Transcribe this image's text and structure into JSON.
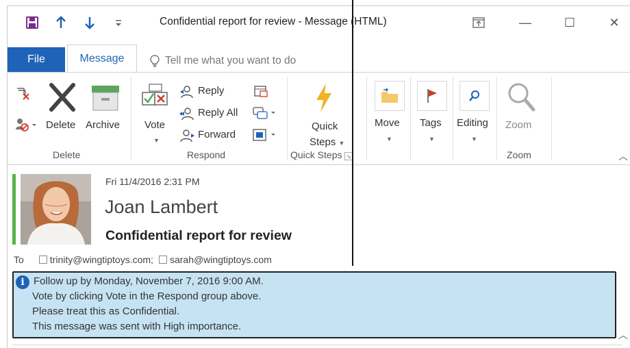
{
  "window": {
    "title": "Confidential report for review  -  Message (HTML)",
    "qat": {
      "save": "save-icon",
      "previous": "up-arrow-icon",
      "next": "down-arrow-icon",
      "customize": "customize-qat-icon"
    },
    "buttons": {
      "restore_ribbon": "ribbon-display-icon",
      "minimize": "—",
      "maximize": "☐",
      "close": "✕"
    }
  },
  "tabs": {
    "file": "File",
    "message": "Message",
    "tell_me": "Tell me what you want to do"
  },
  "ribbon": {
    "delete_group": {
      "label": "Delete",
      "delete": "Delete",
      "archive": "Archive"
    },
    "respond_group": {
      "label": "Respond",
      "vote": "Vote",
      "reply": "Reply",
      "reply_all": "Reply All",
      "forward": "Forward"
    },
    "quick_steps_group": {
      "label": "Quick Steps",
      "quick": "Quick",
      "steps": "Steps"
    },
    "move": "Move",
    "tags": "Tags",
    "editing": "Editing",
    "zoom_group": {
      "label": "Zoom",
      "zoom": "Zoom"
    }
  },
  "message": {
    "date": "Fri 11/4/2016 2:31 PM",
    "sender": "Joan Lambert",
    "subject": "Confidential report for review",
    "to_label": "To",
    "recipients": [
      "trinity@wingtiptoys.com;",
      "sarah@wingtiptoys.com"
    ],
    "infobar": [
      "Follow up by Monday, November 7, 2016 9:00 AM.",
      "Vote by clicking Vote in the Respond group above.",
      "Please treat this as Confidential.",
      "This message was sent with High importance."
    ]
  },
  "colors": {
    "accent": "#1f63b8",
    "infobar": "#c6e3f4",
    "importance_bar": "#5cb345",
    "quick_steps": "#f0b323"
  }
}
